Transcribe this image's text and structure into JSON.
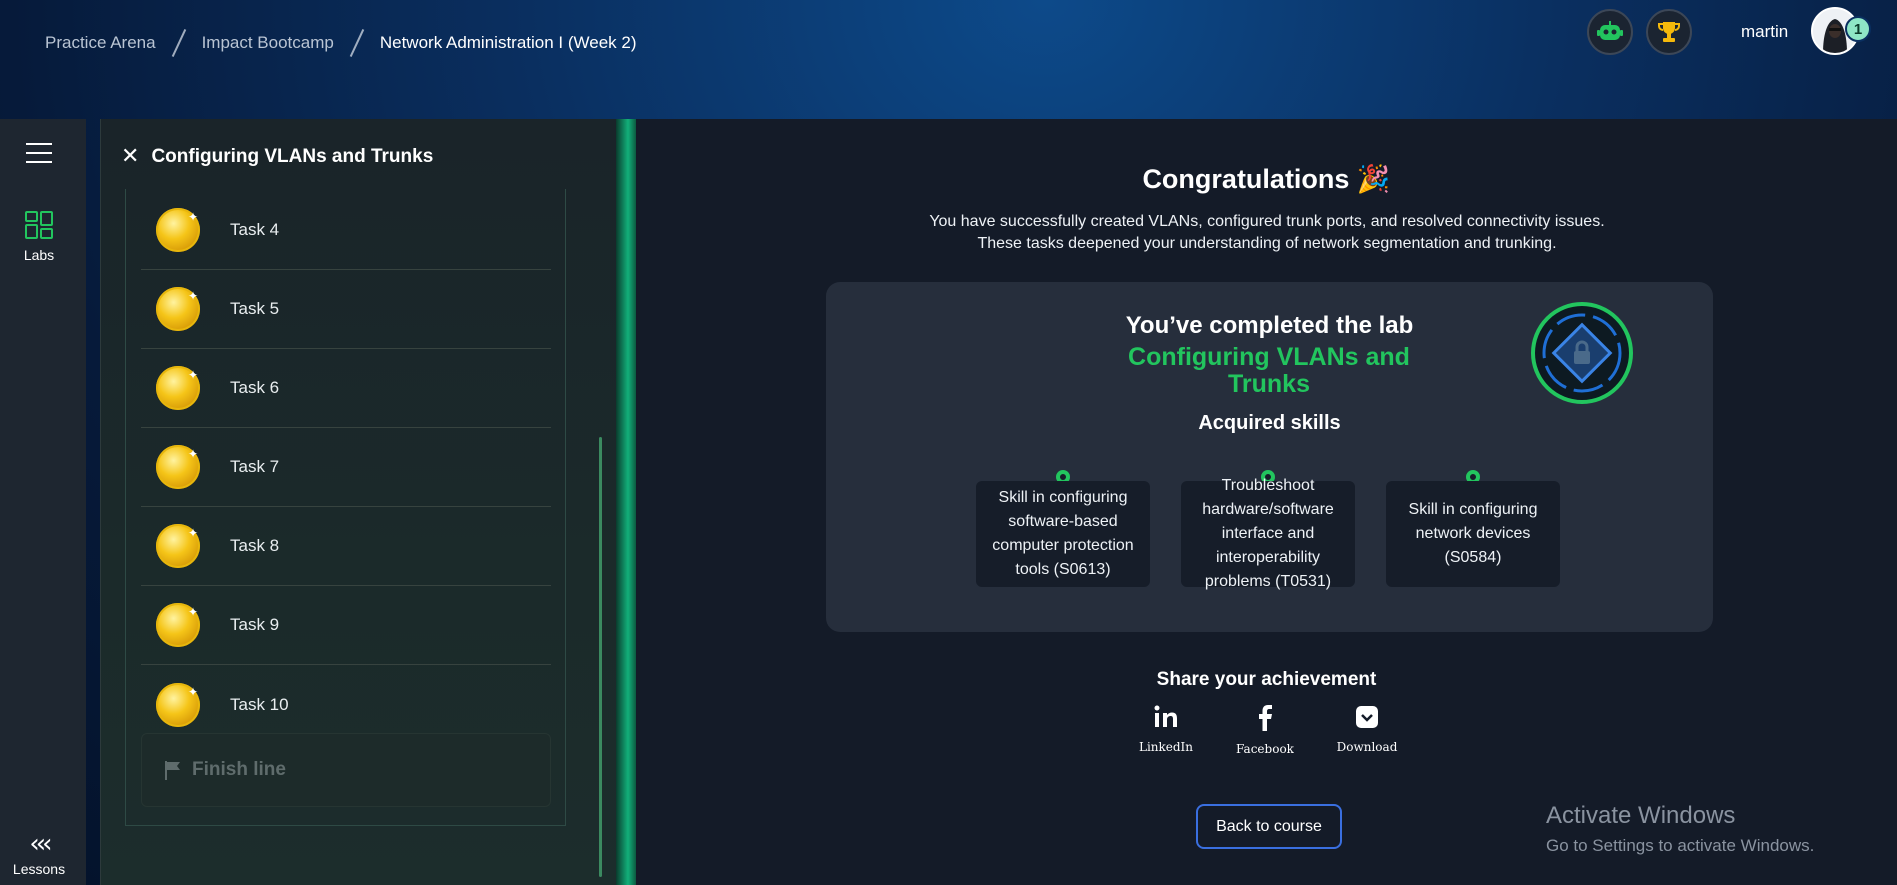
{
  "breadcrumb": [
    "Practice Arena",
    "Impact Bootcamp",
    "Network Administration I (Week 2)"
  ],
  "header": {
    "username": "martin",
    "notification_count": "1",
    "bot_icon": "robot-icon",
    "trophy_icon": "trophy-icon"
  },
  "rail": {
    "labs_label": "Labs",
    "lessons_label": "Lessons",
    "lessons_icon": "«‹‹"
  },
  "panel": {
    "title": "Configuring VLANs and Trunks",
    "close_icon": "✕",
    "tasks": [
      "Task 4",
      "Task 5",
      "Task 6",
      "Task 7",
      "Task 8",
      "Task 9",
      "Task 10"
    ],
    "finish_label": "Finish line"
  },
  "main": {
    "congrats": "Congratulations 🎉",
    "description": "You have successfully created VLANs, configured trunk ports, and resolved connectivity issues. These tasks deepened your understanding of network segmentation and trunking.",
    "completed_title": "You’ve completed the lab",
    "lab_name": "Configuring VLANs and Trunks",
    "skills_head": "Acquired skills",
    "skills": [
      "Skill in configuring software-based computer protection tools (S0613)",
      "Troubleshoot hardware/software interface and interoperability problems (T0531)",
      "Skill in configuring network devices (S0584)"
    ],
    "share_title": "Share your achievement",
    "share": [
      {
        "icon": "in",
        "label": "LinkedIn"
      },
      {
        "icon": "f",
        "label": "Facebook"
      },
      {
        "icon": "⌄",
        "label": "Download"
      }
    ],
    "back_button": "Back to course"
  },
  "watermark": {
    "line1": "Activate Windows",
    "line2": "Go to Settings to activate Windows."
  },
  "colors": {
    "accent_green": "#22c55e",
    "button_border": "#3a6fe0",
    "main_bg": "#141b28"
  }
}
